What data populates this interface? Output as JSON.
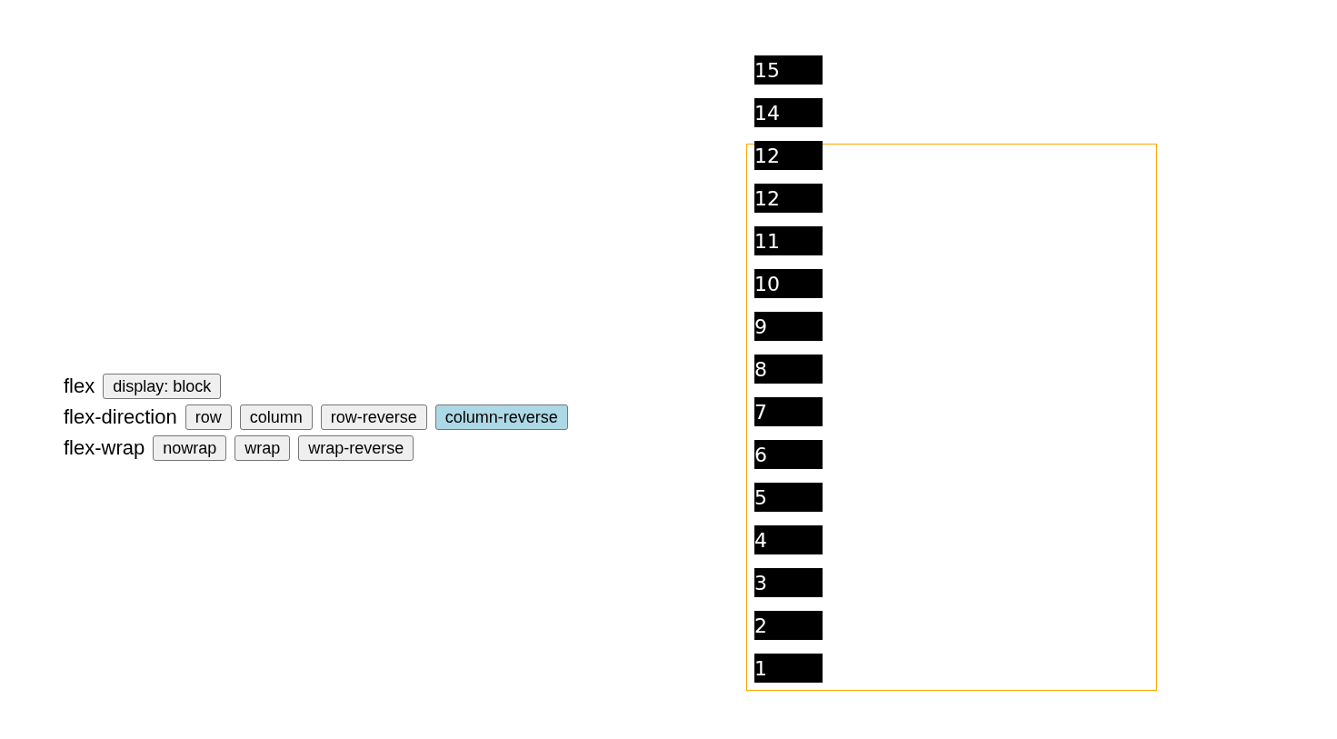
{
  "controls": [
    {
      "label": "flex",
      "options": [
        {
          "label": "display: block",
          "selected": false
        }
      ]
    },
    {
      "label": "flex-direction",
      "options": [
        {
          "label": "row",
          "selected": false
        },
        {
          "label": "column",
          "selected": false
        },
        {
          "label": "row-reverse",
          "selected": false
        },
        {
          "label": "column-reverse",
          "selected": true
        }
      ]
    },
    {
      "label": "flex-wrap",
      "options": [
        {
          "label": "nowrap",
          "selected": false
        },
        {
          "label": "wrap",
          "selected": false
        },
        {
          "label": "wrap-reverse",
          "selected": false
        }
      ]
    }
  ],
  "flex_container": {
    "items": [
      "15",
      "14",
      "12",
      "12",
      "11",
      "10",
      "9",
      "8",
      "7",
      "6",
      "5",
      "4",
      "3",
      "2",
      "1"
    ]
  }
}
